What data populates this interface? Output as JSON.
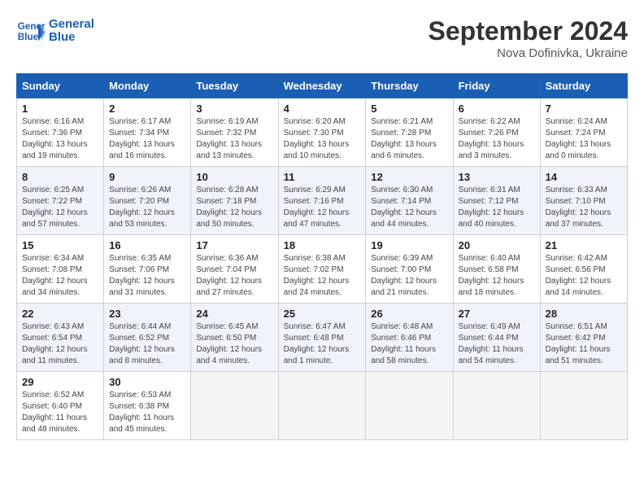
{
  "header": {
    "logo_line1": "General",
    "logo_line2": "Blue",
    "month": "September 2024",
    "location": "Nova Dofinivka, Ukraine"
  },
  "weekdays": [
    "Sunday",
    "Monday",
    "Tuesday",
    "Wednesday",
    "Thursday",
    "Friday",
    "Saturday"
  ],
  "weeks": [
    [
      {
        "day": "1",
        "info": "Sunrise: 6:16 AM\nSunset: 7:36 PM\nDaylight: 13 hours\nand 19 minutes."
      },
      {
        "day": "2",
        "info": "Sunrise: 6:17 AM\nSunset: 7:34 PM\nDaylight: 13 hours\nand 16 minutes."
      },
      {
        "day": "3",
        "info": "Sunrise: 6:19 AM\nSunset: 7:32 PM\nDaylight: 13 hours\nand 13 minutes."
      },
      {
        "day": "4",
        "info": "Sunrise: 6:20 AM\nSunset: 7:30 PM\nDaylight: 13 hours\nand 10 minutes."
      },
      {
        "day": "5",
        "info": "Sunrise: 6:21 AM\nSunset: 7:28 PM\nDaylight: 13 hours\nand 6 minutes."
      },
      {
        "day": "6",
        "info": "Sunrise: 6:22 AM\nSunset: 7:26 PM\nDaylight: 13 hours\nand 3 minutes."
      },
      {
        "day": "7",
        "info": "Sunrise: 6:24 AM\nSunset: 7:24 PM\nDaylight: 13 hours\nand 0 minutes."
      }
    ],
    [
      {
        "day": "8",
        "info": "Sunrise: 6:25 AM\nSunset: 7:22 PM\nDaylight: 12 hours\nand 57 minutes."
      },
      {
        "day": "9",
        "info": "Sunrise: 6:26 AM\nSunset: 7:20 PM\nDaylight: 12 hours\nand 53 minutes."
      },
      {
        "day": "10",
        "info": "Sunrise: 6:28 AM\nSunset: 7:18 PM\nDaylight: 12 hours\nand 50 minutes."
      },
      {
        "day": "11",
        "info": "Sunrise: 6:29 AM\nSunset: 7:16 PM\nDaylight: 12 hours\nand 47 minutes."
      },
      {
        "day": "12",
        "info": "Sunrise: 6:30 AM\nSunset: 7:14 PM\nDaylight: 12 hours\nand 44 minutes."
      },
      {
        "day": "13",
        "info": "Sunrise: 6:31 AM\nSunset: 7:12 PM\nDaylight: 12 hours\nand 40 minutes."
      },
      {
        "day": "14",
        "info": "Sunrise: 6:33 AM\nSunset: 7:10 PM\nDaylight: 12 hours\nand 37 minutes."
      }
    ],
    [
      {
        "day": "15",
        "info": "Sunrise: 6:34 AM\nSunset: 7:08 PM\nDaylight: 12 hours\nand 34 minutes."
      },
      {
        "day": "16",
        "info": "Sunrise: 6:35 AM\nSunset: 7:06 PM\nDaylight: 12 hours\nand 31 minutes."
      },
      {
        "day": "17",
        "info": "Sunrise: 6:36 AM\nSunset: 7:04 PM\nDaylight: 12 hours\nand 27 minutes."
      },
      {
        "day": "18",
        "info": "Sunrise: 6:38 AM\nSunset: 7:02 PM\nDaylight: 12 hours\nand 24 minutes."
      },
      {
        "day": "19",
        "info": "Sunrise: 6:39 AM\nSunset: 7:00 PM\nDaylight: 12 hours\nand 21 minutes."
      },
      {
        "day": "20",
        "info": "Sunrise: 6:40 AM\nSunset: 6:58 PM\nDaylight: 12 hours\nand 18 minutes."
      },
      {
        "day": "21",
        "info": "Sunrise: 6:42 AM\nSunset: 6:56 PM\nDaylight: 12 hours\nand 14 minutes."
      }
    ],
    [
      {
        "day": "22",
        "info": "Sunrise: 6:43 AM\nSunset: 6:54 PM\nDaylight: 12 hours\nand 11 minutes."
      },
      {
        "day": "23",
        "info": "Sunrise: 6:44 AM\nSunset: 6:52 PM\nDaylight: 12 hours\nand 8 minutes."
      },
      {
        "day": "24",
        "info": "Sunrise: 6:45 AM\nSunset: 6:50 PM\nDaylight: 12 hours\nand 4 minutes."
      },
      {
        "day": "25",
        "info": "Sunrise: 6:47 AM\nSunset: 6:48 PM\nDaylight: 12 hours\nand 1 minute."
      },
      {
        "day": "26",
        "info": "Sunrise: 6:48 AM\nSunset: 6:46 PM\nDaylight: 11 hours\nand 58 minutes."
      },
      {
        "day": "27",
        "info": "Sunrise: 6:49 AM\nSunset: 6:44 PM\nDaylight: 11 hours\nand 54 minutes."
      },
      {
        "day": "28",
        "info": "Sunrise: 6:51 AM\nSunset: 6:42 PM\nDaylight: 11 hours\nand 51 minutes."
      }
    ],
    [
      {
        "day": "29",
        "info": "Sunrise: 6:52 AM\nSunset: 6:40 PM\nDaylight: 11 hours\nand 48 minutes."
      },
      {
        "day": "30",
        "info": "Sunrise: 6:53 AM\nSunset: 6:38 PM\nDaylight: 11 hours\nand 45 minutes."
      },
      null,
      null,
      null,
      null,
      null
    ]
  ]
}
